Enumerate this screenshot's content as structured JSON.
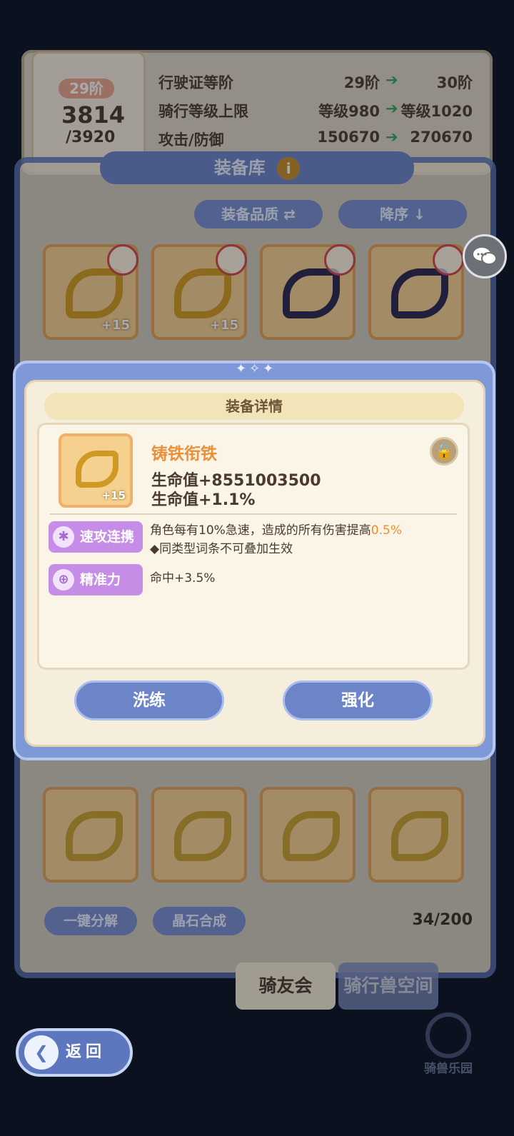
{
  "license": {
    "tier_badge": "29阶",
    "points_current": "3814",
    "points_max": "/3920",
    "rows": [
      {
        "label": "行驶证等阶",
        "current": "29阶",
        "next": "30阶"
      },
      {
        "label": "骑行等级上限",
        "current": "等级980",
        "next": "等级1020"
      },
      {
        "label": "攻击/防御",
        "current": "150670",
        "next": "270670"
      }
    ],
    "arrow_symbol": "➔"
  },
  "library": {
    "title": "装备库",
    "info_symbol": "i",
    "filter_quality": "装备品质 ⇄",
    "filter_order": "降序 ↓",
    "row1_plus": [
      "+15",
      "+15",
      "",
      ""
    ],
    "decompose_label": "一键分解",
    "synthesize_label": "晶石合成",
    "capacity": "34/200"
  },
  "chat": {
    "icon": "chat-icon"
  },
  "detail": {
    "title": "装备详情",
    "deco": "✦✧✦",
    "item_name": "铸铁衔铁",
    "item_plus": "+15",
    "stat1": "生命值+8551003500",
    "stat2": "生命值+1.1%",
    "lock_symbol": "🔓",
    "affix1_label": "速攻连携",
    "affix1_desc_prefix": "角色每有10%急速，造成的所有伤害提高",
    "affix1_desc_value": "0.5%",
    "affix1_desc_line2": "◆同类型词条不可叠加生效",
    "affix2_label": "精准力",
    "affix2_desc": "命中+3.5%",
    "refine_label": "洗练",
    "enhance_label": "强化"
  },
  "tabs": {
    "club": "骑友会",
    "space": "骑行兽空间"
  },
  "nav": {
    "back_label": "返回",
    "back_arrow": "❮",
    "park_label": "骑兽乐园"
  },
  "colors": {
    "accent_blue": "#6c84c8",
    "affix_purple": "#c58de5",
    "highlight_orange": "#f08c2f"
  }
}
